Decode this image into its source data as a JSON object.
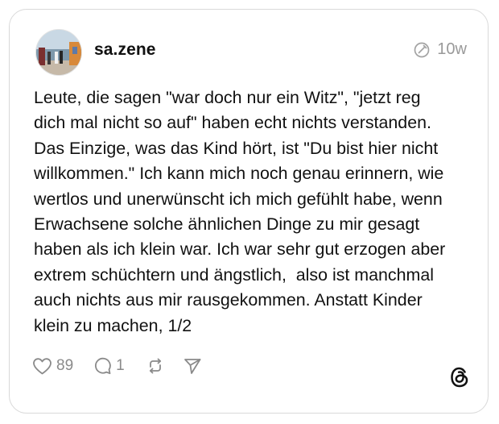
{
  "post": {
    "username": "sa.zene",
    "time_ago": "10w",
    "text": "Leute, die sagen \"war doch nur ein Witz\", \"jetzt reg\ndich mal nicht so auf\" haben echt nichts verstanden.\nDas Einzige, was das Kind hört, ist \"Du bist hier nicht\nwillkommen.\" Ich kann mich noch genau erinnern, wie\nwertlos und unerwünscht ich mich gefühlt habe, wenn\nErwachsene solche ähnlichen Dinge zu mir gesagt\nhaben als ich klein war. Ich war sehr gut erzogen aber\nextrem schüchtern und ängstlich,  also ist manchmal\nauch nichts aus mir rausgekommen. Anstatt Kinder\nklein zu machen, 1/2"
  },
  "actions": {
    "likes": "89",
    "replies": "1"
  },
  "icons": {
    "edited": "edited-icon",
    "like": "heart-icon",
    "reply": "comment-icon",
    "repost": "repost-icon",
    "share": "send-icon",
    "brand": "threads-logo-icon"
  }
}
